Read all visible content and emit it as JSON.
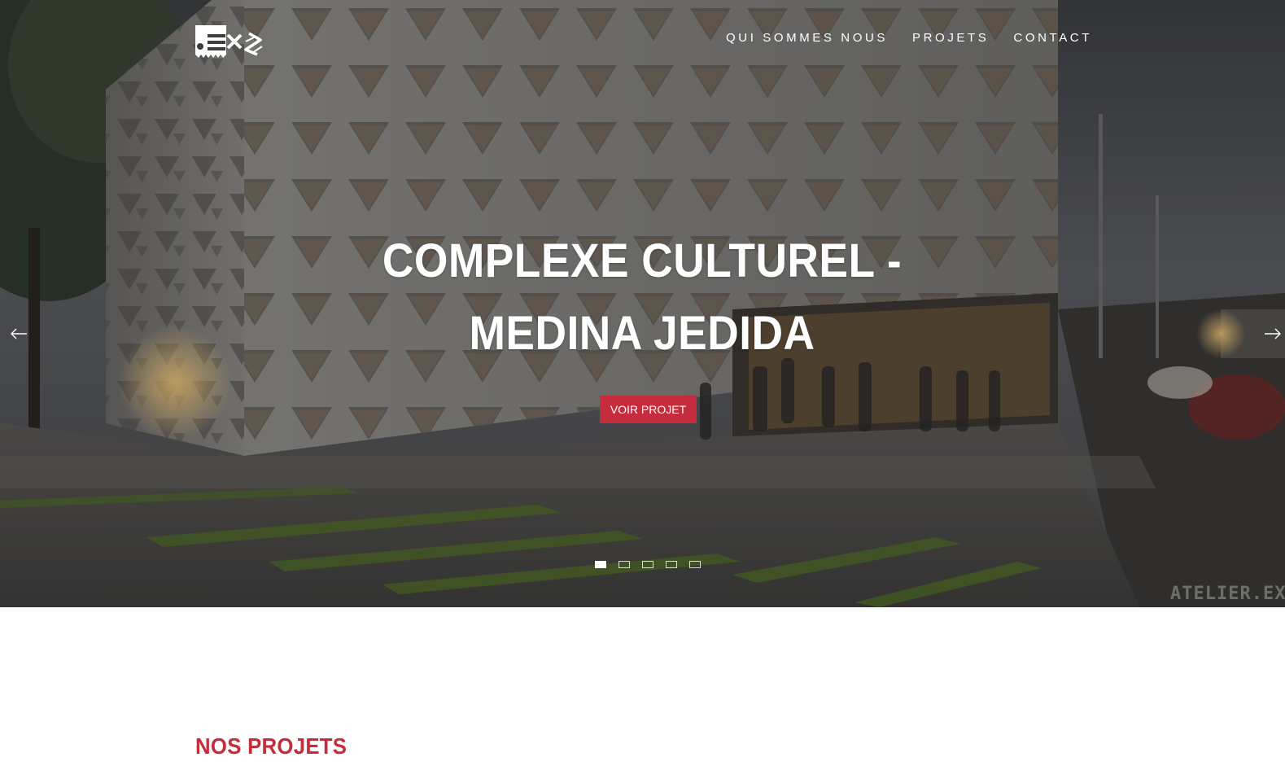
{
  "header": {
    "nav": [
      {
        "label": "QUI SOMMES NOUS"
      },
      {
        "label": "PROJETS"
      },
      {
        "label": "CONTACT"
      }
    ]
  },
  "hero": {
    "title_line1": "COMPLEXE CULTUREL -",
    "title_line2": "MEDINA JEDIDA",
    "cta_label": "VOIR PROJET",
    "slide_count": 5,
    "active_slide": 1,
    "watermark": "ATELIER.EXE"
  },
  "main": {
    "section_title": "NOS PROJETS"
  },
  "colors": {
    "accent": "#c62d3c",
    "white": "#ffffff"
  },
  "icons": {
    "prev": "arrow-left-icon",
    "next": "arrow-right-icon"
  }
}
